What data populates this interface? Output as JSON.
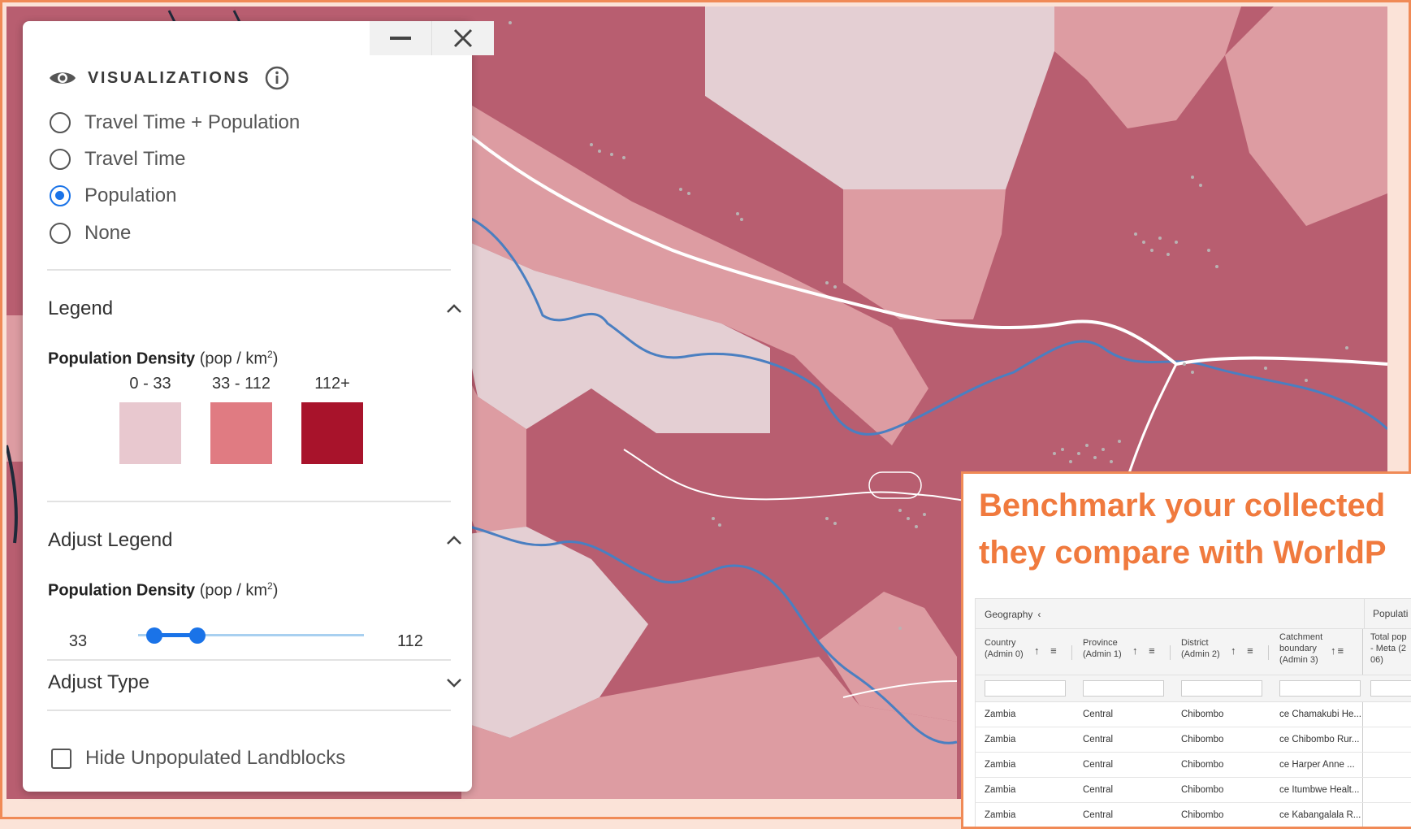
{
  "panel": {
    "title": "VISUALIZATIONS",
    "options": [
      {
        "label": "Travel Time + Population",
        "selected": false
      },
      {
        "label": "Travel Time",
        "selected": false
      },
      {
        "label": "Population",
        "selected": true
      },
      {
        "label": "None",
        "selected": false
      }
    ],
    "legend": {
      "title": "Legend",
      "metric_bold": "Population Density",
      "metric_unit": "(pop / km",
      "metric_sup": "2",
      "metric_close": ")",
      "ranges": [
        {
          "label": "0 - 33",
          "color": "#e8c8cf"
        },
        {
          "label": "33 - 112",
          "color": "#e07b82"
        },
        {
          "label": "112+",
          "color": "#a8132b"
        }
      ]
    },
    "adjust_legend": {
      "title": "Adjust Legend",
      "metric_bold": "Population Density",
      "metric_unit": "(pop / km",
      "metric_sup": "2",
      "metric_close": ")",
      "min": "33",
      "max": "112"
    },
    "adjust_type": {
      "title": "Adjust Type"
    },
    "hide_unpopulated": {
      "label": "Hide Unpopulated Landblocks",
      "checked": false
    }
  },
  "callout": {
    "heading_line1": "Benchmark your collected",
    "heading_line2": "they compare with WorldP",
    "table": {
      "group_label": "Geography",
      "group_label2": "Populati",
      "columns": [
        {
          "line1": "Country",
          "line2": "(Admin 0)",
          "line3": ""
        },
        {
          "line1": "Province",
          "line2": "(Admin 1)",
          "line3": ""
        },
        {
          "line1": "District",
          "line2": "(Admin 2)",
          "line3": ""
        },
        {
          "line1": "Catchment",
          "line2": "boundary",
          "line3": "(Admin 3)"
        },
        {
          "line1": "Total pop",
          "line2": "- Meta (2",
          "line3": "06)"
        }
      ],
      "rows": [
        [
          "Zambia",
          "Central",
          "Chibombo",
          "ce Chamakubi He..."
        ],
        [
          "Zambia",
          "Central",
          "Chibombo",
          "ce Chibombo Rur..."
        ],
        [
          "Zambia",
          "Central",
          "Chibombo",
          "ce Harper Anne ..."
        ],
        [
          "Zambia",
          "Central",
          "Chibombo",
          "ce Itumbwe Healt..."
        ],
        [
          "Zambia",
          "Central",
          "Chibombo",
          "ce Kabangalala R..."
        ]
      ]
    }
  },
  "colors": {
    "density_low": "#e4cfd3",
    "density_mid": "#dd9ca2",
    "density_high": "#b85e70",
    "river": "#4a7fc1",
    "road": "#ffffff",
    "accent": "#f07a3e",
    "selection": "#1a73e8"
  }
}
